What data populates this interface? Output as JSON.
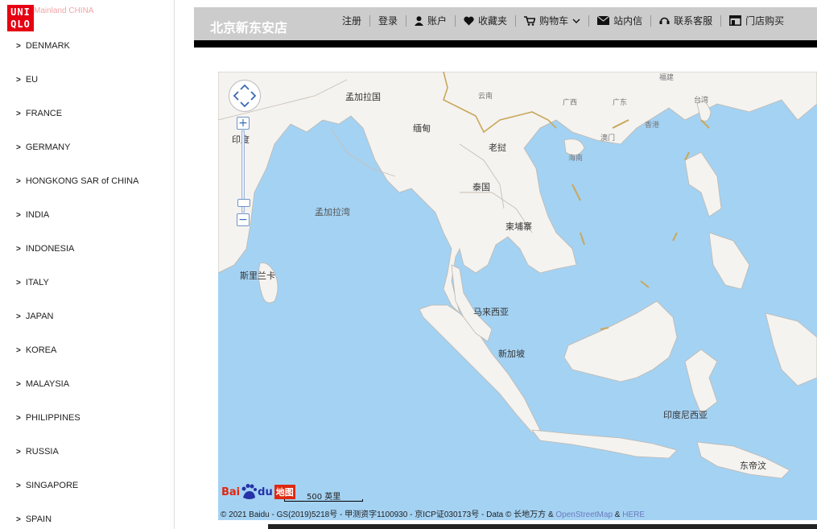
{
  "brand": {
    "logo_line1": "UNI",
    "logo_line2": "QLO",
    "overlap_text": "Mainland CHINA"
  },
  "sidebar": {
    "countries": [
      "DENMARK",
      "EU",
      "FRANCE",
      "GERMANY",
      "HONGKONG SAR of CHINA",
      "INDIA",
      "INDONESIA",
      "ITALY",
      "JAPAN",
      "KOREA",
      "MALAYSIA",
      "PHILIPPINES",
      "RUSSIA",
      "SINGAPORE",
      "SPAIN"
    ],
    "arrow": ">"
  },
  "header": {
    "store_name": "北京新东安店",
    "nav": {
      "register": "注册",
      "login": "登录",
      "account": "账户",
      "favorites": "收藏夹",
      "cart": "购物车",
      "messages": "站内信",
      "contact": "联系客服",
      "store_buy": "门店购买"
    }
  },
  "map": {
    "labels": {
      "bangladesh": "孟加拉国",
      "myanmar": "缅甸",
      "india": "印度",
      "laos": "老挝",
      "thailand": "泰国",
      "cambodia": "柬埔寨",
      "bay_of_bengal": "孟加拉湾",
      "sri_lanka": "斯里兰卡",
      "malaysia": "马来西亚",
      "singapore": "新加坡",
      "indonesia": "印度尼西亚",
      "east_timor": "东帝汶",
      "yunnan": "云南",
      "guangxi": "广西",
      "guangdong": "广东",
      "fujian": "福建",
      "taiwan": "台湾",
      "hongkong": "香港",
      "macau": "澳门",
      "hainan": "海南"
    },
    "zoom_in": "+",
    "zoom_out": "−",
    "logo_text": "Bai",
    "logo_text2": "du",
    "logo_text3": "地图",
    "scale": "500 英里",
    "copyright_main": "© 2021 Baidu - GS(2019)5218号 - 甲测资字1100930 - 京ICP证030173号 - Data © 长地万方 &",
    "copyright_osm": "OpenStreetMap",
    "copyright_amp": "&",
    "copyright_here": "HERE"
  }
}
